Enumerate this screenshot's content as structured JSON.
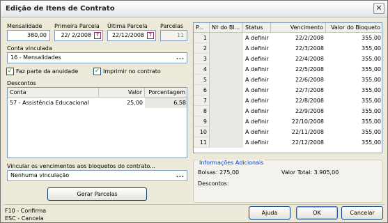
{
  "window": {
    "title": "Edição de Itens de Contrato",
    "close_glyph": "✕"
  },
  "fields": {
    "mensalidade": {
      "label": "Mensalidade",
      "value": "380,00"
    },
    "primeira_parcela": {
      "label": "Primeira Parcela",
      "value": "22/ 2/2008"
    },
    "ultima_parcela": {
      "label": "Última Parcela",
      "value": "22/12/2008"
    },
    "parcelas": {
      "label": "Parcelas",
      "value": "11"
    },
    "conta_vinculada": {
      "label": "Conta vinculada",
      "value": "16 - Mensalidades"
    },
    "vincular": {
      "label": "Vincular os vencimentos aos bloquetos do contrato...",
      "value": "Nenhuma vinculação"
    }
  },
  "checkboxes": {
    "faz_parte": {
      "label": "Faz parte da anuidade",
      "checked": true
    },
    "imprimir": {
      "label": "Imprimir no contrato",
      "checked": true
    }
  },
  "descontos": {
    "label": "Descontos",
    "columns": [
      "Conta",
      "Valor",
      "Porcentagem"
    ],
    "rows": [
      {
        "conta": "57 - Assistência Educacional",
        "valor": "25,00",
        "porcentagem": "6,58"
      }
    ]
  },
  "parcelas_grid": {
    "columns": [
      "P...",
      "Nº do Bl...",
      "Status",
      "Vencimento",
      "Valor do Bloqueto"
    ],
    "rows": [
      {
        "n": "1",
        "bloq": "",
        "status": "A definir",
        "venc": "22/2/2008",
        "valor": "355,00"
      },
      {
        "n": "2",
        "bloq": "",
        "status": "A definir",
        "venc": "22/3/2008",
        "valor": "355,00"
      },
      {
        "n": "3",
        "bloq": "",
        "status": "A definir",
        "venc": "22/4/2008",
        "valor": "355,00"
      },
      {
        "n": "4",
        "bloq": "",
        "status": "A definir",
        "venc": "22/5/2008",
        "valor": "355,00"
      },
      {
        "n": "5",
        "bloq": "",
        "status": "A definir",
        "venc": "22/6/2008",
        "valor": "355,00"
      },
      {
        "n": "6",
        "bloq": "",
        "status": "A definir",
        "venc": "22/7/2008",
        "valor": "355,00"
      },
      {
        "n": "7",
        "bloq": "",
        "status": "A definir",
        "venc": "22/8/2008",
        "valor": "355,00"
      },
      {
        "n": "8",
        "bloq": "",
        "status": "A definir",
        "venc": "22/9/2008",
        "valor": "355,00"
      },
      {
        "n": "9",
        "bloq": "",
        "status": "A definir",
        "venc": "22/10/2008",
        "valor": "355,00"
      },
      {
        "n": "10",
        "bloq": "",
        "status": "A definir",
        "venc": "22/11/2008",
        "valor": "355,00"
      },
      {
        "n": "11",
        "bloq": "",
        "status": "A definir",
        "venc": "22/12/2008",
        "valor": "355,00"
      }
    ]
  },
  "info": {
    "title": "Informações Adicionais",
    "bolsas": "Bolsas: 275,00",
    "valor_total": "Valor Total: 3.905,00",
    "descontos": "Descontos:"
  },
  "buttons": {
    "gerar": "Gerar Parcelas",
    "ajuda": "Ajuda",
    "ok": "OK",
    "cancelar": "Cancelar"
  },
  "hints": {
    "f10": "F10 - Confirma",
    "esc": "ESC - Cancela"
  },
  "icons": {
    "calendar": "calendar-icon",
    "ellipsis": "..."
  },
  "colors": {
    "accent": "#0046d5",
    "check": "#21a121",
    "border": "#7f9db9"
  }
}
